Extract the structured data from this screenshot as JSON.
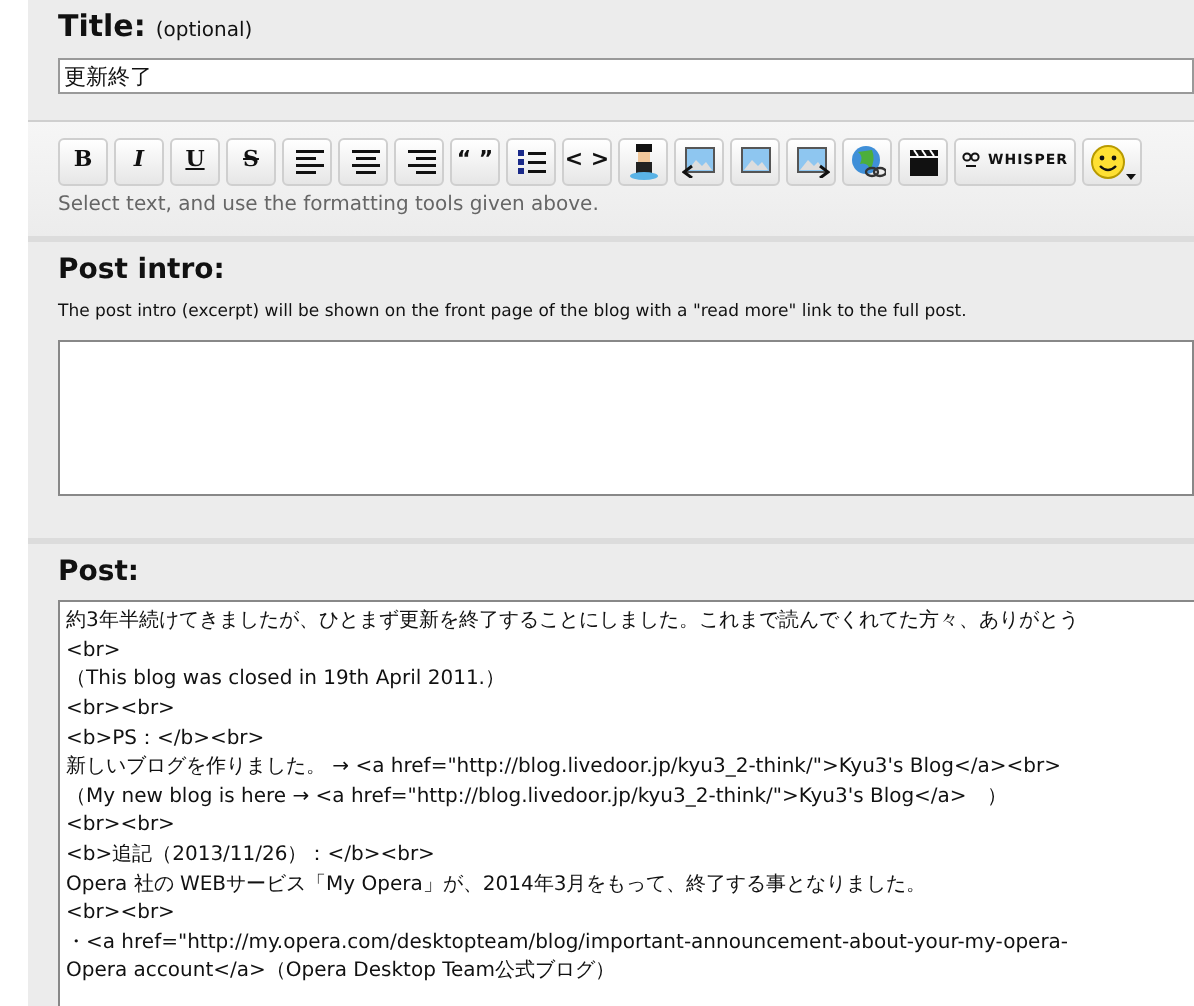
{
  "title_section": {
    "heading": "Title:",
    "note": "(optional)",
    "value": "更新終了"
  },
  "toolbar": [
    {
      "kind": "bold",
      "label": "B"
    },
    {
      "kind": "italic",
      "label": "I"
    },
    {
      "kind": "underline",
      "label": "U"
    },
    {
      "kind": "strike",
      "label": "S"
    },
    {
      "kind": "align-left"
    },
    {
      "kind": "align-center"
    },
    {
      "kind": "align-right"
    },
    {
      "kind": "quote",
      "label": "“ ”"
    },
    {
      "kind": "list"
    },
    {
      "kind": "code",
      "label": "< >"
    },
    {
      "kind": "figure"
    },
    {
      "kind": "image-left"
    },
    {
      "kind": "image"
    },
    {
      "kind": "image-right"
    },
    {
      "kind": "globe-link"
    },
    {
      "kind": "clapper"
    },
    {
      "kind": "whisper",
      "label": "WHISPER"
    },
    {
      "kind": "smiley"
    }
  ],
  "toolbar_hint": "Select text, and use the formatting tools given above.",
  "post_intro": {
    "heading": "Post intro:",
    "description": "The post intro (excerpt) will be shown on the front page of the blog with a \"read more\" link to the full post."
  },
  "post": {
    "heading": "Post:",
    "lines": [
      "約3年半続けてきましたが、ひとまず更新を終了することにしました。これまで読んでくれてた方々、ありがとう",
      "<br>",
      "（This blog was closed in 19th April 2011.）",
      "<br><br>",
      "<b>PS：</b><br>",
      "新しいブログを作りました。 → <a href=\"http://blog.livedoor.jp/kyu3_2-think/\">Kyu3's Blog</a><br>",
      "（My new blog is here → <a href=\"http://blog.livedoor.jp/kyu3_2-think/\">Kyu3's Blog</a>　）",
      "<br><br>",
      "<b>追記（2013/11/26）：</b><br>",
      "Opera 社の WEBサービス「My Opera」が、2014年3月をもって、終了する事となりました。",
      "<br><br>",
      "・<a href=\"http://my.opera.com/desktopteam/blog/important-announcement-about-your-my-opera-",
      "Opera account</a>（Opera Desktop Team公式ブログ）"
    ]
  }
}
